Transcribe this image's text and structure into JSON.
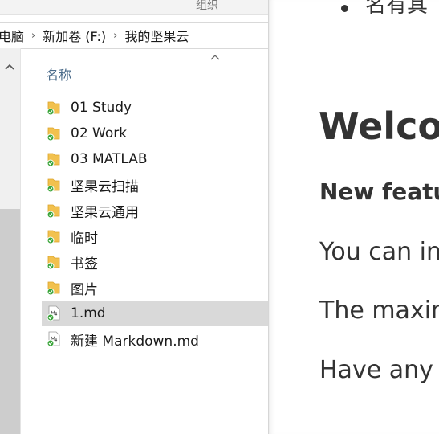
{
  "ribbon": {
    "group_label": "组织"
  },
  "address_bar": {
    "crumbs": [
      "电脑",
      "新加卷 (F:)",
      "我的坚果云"
    ],
    "separator": "›"
  },
  "file_list": {
    "column_header": "名称",
    "items": [
      {
        "name": "01 Study",
        "type": "folder",
        "sync_status": "synced"
      },
      {
        "name": "02 Work",
        "type": "folder",
        "sync_status": "synced"
      },
      {
        "name": "03 MATLAB",
        "type": "folder",
        "sync_status": "synced"
      },
      {
        "name": "坚果云扫描",
        "type": "folder",
        "sync_status": "synced"
      },
      {
        "name": "坚果云通用",
        "type": "folder",
        "sync_status": "synced"
      },
      {
        "name": "临时",
        "type": "folder",
        "sync_status": "synced"
      },
      {
        "name": "书签",
        "type": "folder",
        "sync_status": "synced"
      },
      {
        "name": "图片",
        "type": "folder",
        "sync_status": "synced"
      },
      {
        "name": "1.md",
        "type": "markdown-file",
        "sync_status": "synced",
        "selected": true
      },
      {
        "name": "新建 Markdown.md",
        "type": "markdown-file",
        "sync_status": "synced"
      }
    ]
  },
  "preview": {
    "list_item_fragment": "名有其",
    "heading": "Welcor",
    "subheading": "New featu",
    "paragraphs": [
      "You can ins",
      "The maxim",
      "Have any c"
    ]
  },
  "colors": {
    "folder": "#f2c14e",
    "folder_dark": "#dba42a",
    "sync_badge": "#3aa53a",
    "selected_row": "#d9d9d9",
    "header_text": "#4a6b8a"
  }
}
